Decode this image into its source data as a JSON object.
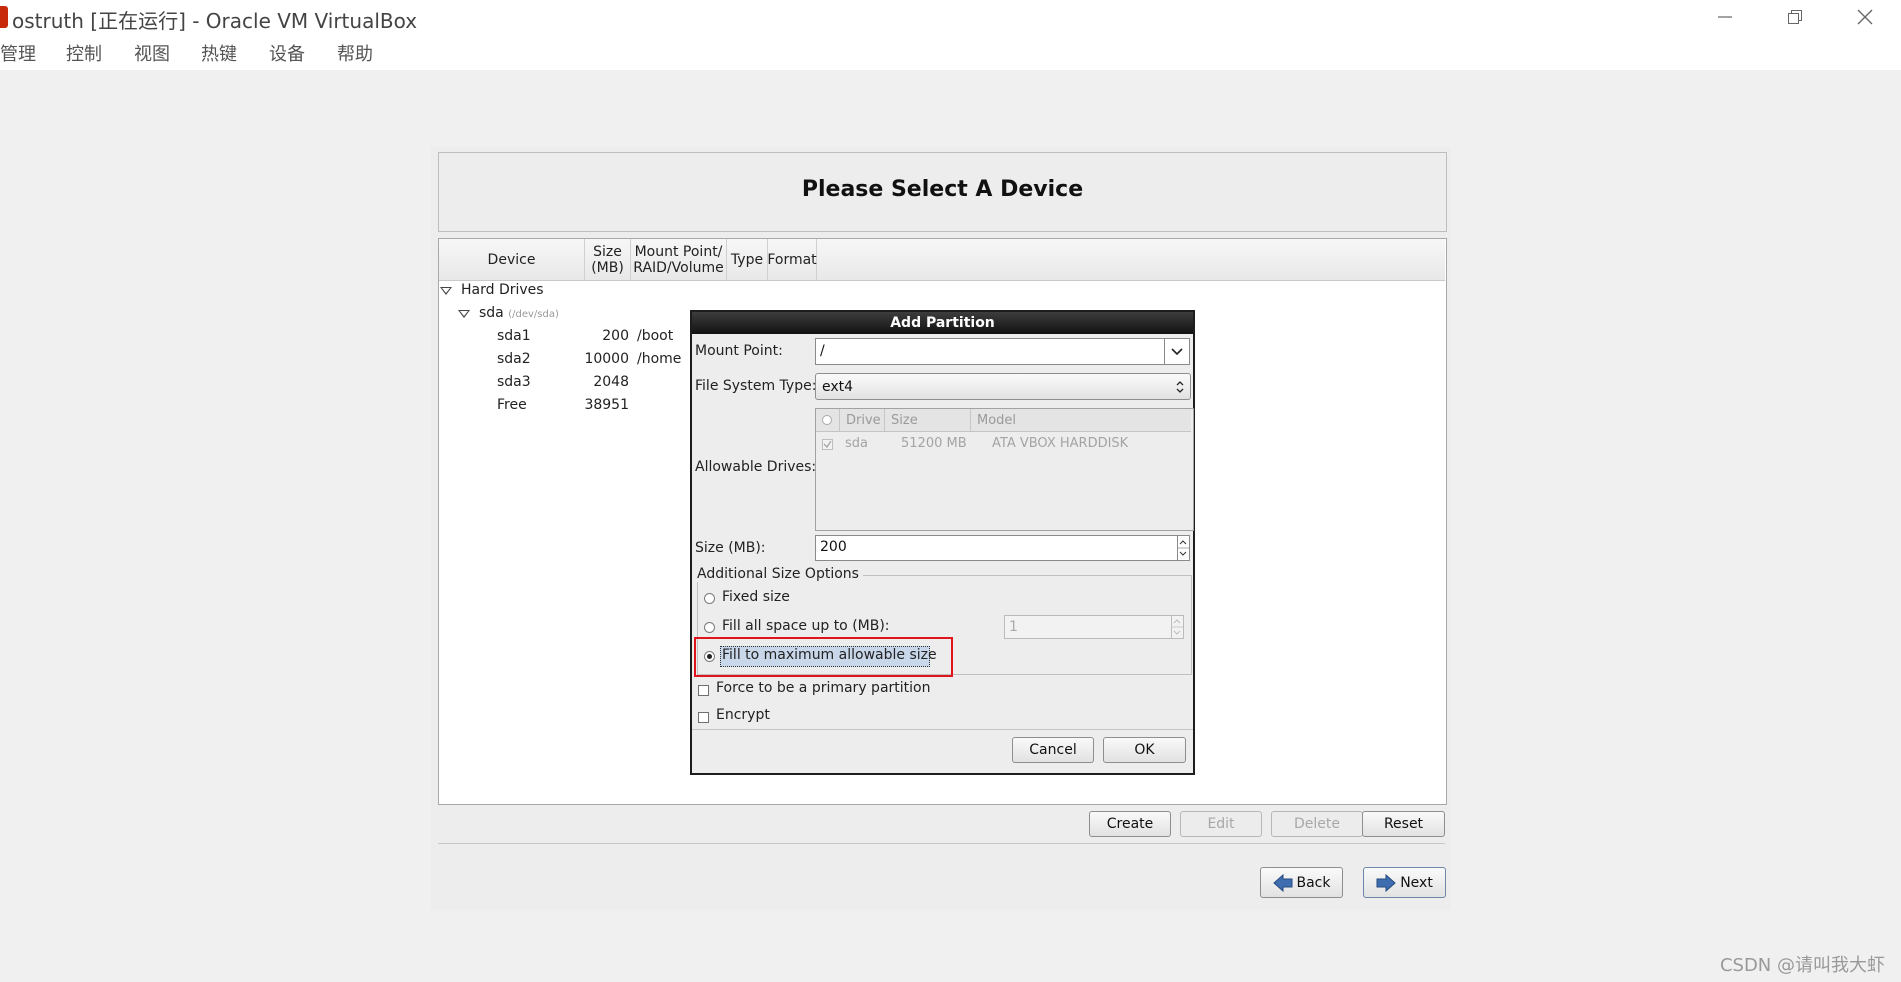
{
  "window": {
    "title": "ostruth [正在运行] - Oracle VM VirtualBox",
    "controls": {
      "minimize": "—",
      "restore": "❐",
      "close": "✕"
    }
  },
  "menubar": {
    "items": [
      "管理",
      "控制",
      "视图",
      "热键",
      "设备",
      "帮助"
    ]
  },
  "installer": {
    "page_title": "Please Select A Device",
    "columns": [
      "Device",
      "Size\n(MB)",
      "Mount Point/\nRAID/Volume",
      "Type",
      "Format"
    ],
    "tree": {
      "group_label": "Hard Drives",
      "disk_name": "sda",
      "disk_path": "(/dev/sda)",
      "partitions": [
        {
          "device": "sda1",
          "size": "200",
          "mount": "/boot"
        },
        {
          "device": "sda2",
          "size": "10000",
          "mount": "/home"
        },
        {
          "device": "sda3",
          "size": "2048",
          "mount": ""
        },
        {
          "device": "Free",
          "size": "38951",
          "mount": ""
        }
      ]
    },
    "actions": {
      "create": "Create",
      "edit": "Edit",
      "delete": "Delete",
      "reset": "Reset"
    },
    "nav": {
      "back": "Back",
      "next": "Next"
    }
  },
  "dialog": {
    "title": "Add Partition",
    "mount_point_label": "Mount Point:",
    "mount_point_value": "/",
    "fs_type_label": "File System Type:",
    "fs_type_value": "ext4",
    "allowable_drives_label": "Allowable Drives:",
    "drives_columns": [
      "Drive",
      "Size",
      "Model"
    ],
    "drives": [
      {
        "checked": true,
        "drive": "sda",
        "size": "51200 MB",
        "model": "ATA VBOX HARDDISK"
      }
    ],
    "size_label": "Size (MB):",
    "size_value": "200",
    "size_options_label": "Additional Size Options",
    "size_options": {
      "fixed": "Fixed size",
      "fill_up_to": "Fill all space up to (MB):",
      "fill_up_to_value": "1",
      "fill_max": "Fill to maximum allowable size",
      "selected": "fill_max"
    },
    "force_primary_label": "Force to be a primary partition",
    "encrypt_label": "Encrypt",
    "cancel": "Cancel",
    "ok": "OK",
    "highlight_color": "#e0151b"
  },
  "watermark": "CSDN @请叫我大虾"
}
